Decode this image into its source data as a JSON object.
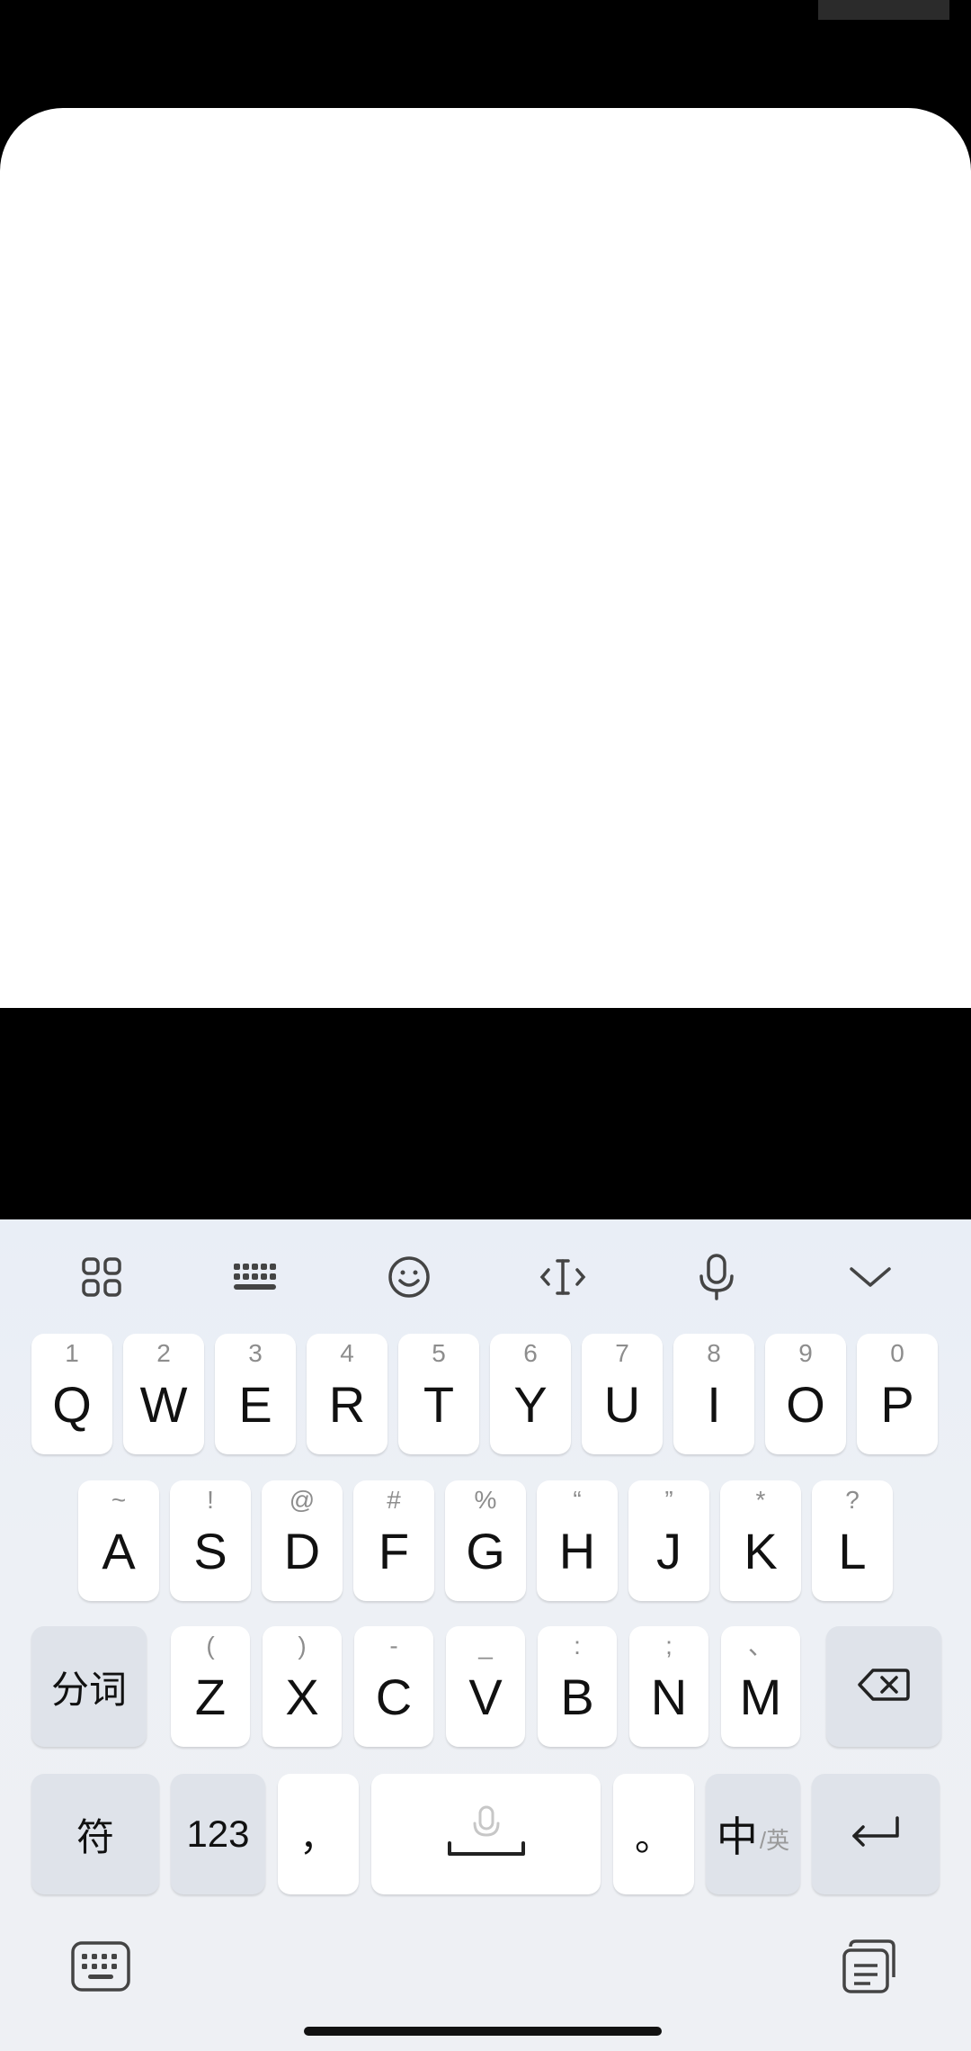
{
  "keyboard": {
    "toolbar": [
      {
        "name": "apps-grid-icon"
      },
      {
        "name": "keyboard-layout-icon"
      },
      {
        "name": "emoji-icon"
      },
      {
        "name": "cursor-move-icon"
      },
      {
        "name": "voice-input-icon"
      },
      {
        "name": "collapse-keyboard-icon"
      }
    ],
    "row1": [
      {
        "key": "Q",
        "hint": "1"
      },
      {
        "key": "W",
        "hint": "2"
      },
      {
        "key": "E",
        "hint": "3"
      },
      {
        "key": "R",
        "hint": "4"
      },
      {
        "key": "T",
        "hint": "5"
      },
      {
        "key": "Y",
        "hint": "6"
      },
      {
        "key": "U",
        "hint": "7"
      },
      {
        "key": "I",
        "hint": "8"
      },
      {
        "key": "O",
        "hint": "9"
      },
      {
        "key": "P",
        "hint": "0"
      }
    ],
    "row2": [
      {
        "key": "A",
        "hint": "~"
      },
      {
        "key": "S",
        "hint": "!"
      },
      {
        "key": "D",
        "hint": "@"
      },
      {
        "key": "F",
        "hint": "#"
      },
      {
        "key": "G",
        "hint": "%"
      },
      {
        "key": "H",
        "hint": "“"
      },
      {
        "key": "J",
        "hint": "”"
      },
      {
        "key": "K",
        "hint": "*"
      },
      {
        "key": "L",
        "hint": "?"
      }
    ],
    "row3": [
      {
        "key": "Z",
        "hint": "("
      },
      {
        "key": "X",
        "hint": ")"
      },
      {
        "key": "C",
        "hint": "-"
      },
      {
        "key": "V",
        "hint": "_"
      },
      {
        "key": "B",
        "hint": ":"
      },
      {
        "key": "N",
        "hint": ";"
      },
      {
        "key": "M",
        "hint": "、"
      }
    ],
    "segment_label": "分词",
    "symbols_label": "符",
    "numbers_label": "123",
    "comma_label": "，",
    "period_label": "。",
    "lang_main": "中",
    "lang_sub": "/英",
    "backspace_icon": "backspace-icon",
    "enter_icon": "enter-icon",
    "space_icon": "space-mic-icon",
    "bottom_left_icon": "keyboard-switch-icon",
    "bottom_right_icon": "clipboard-icon"
  }
}
